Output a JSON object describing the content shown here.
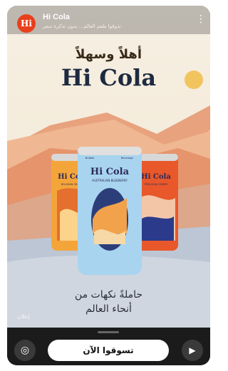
{
  "header": {
    "brand": "Hi Cola",
    "subtitle": "تذوقوا طعم العالم... بدون تذكرة سفر",
    "logo_text": "Hi",
    "menu_icon": "more-vertical-icon"
  },
  "hero": {
    "greeting": "أهلاً وسهلاً",
    "title": "Hi Cola",
    "tagline_line1": "حاملةً نكهات من",
    "tagline_line2": "أنحاء العالم"
  },
  "cans": {
    "left": {
      "brand": "Hi Cola",
      "flavor": "BOLIVIAN ORANGE"
    },
    "center": {
      "brand": "Hi Cola",
      "flavor": "AUSTRALIAN BLUEBERRY",
      "top_left": "Bubble",
      "top_right": "Beverage"
    },
    "right": {
      "brand": "Hi Cola",
      "flavor": "PERUVIAN CHERRY"
    }
  },
  "watermark": "إعلان",
  "actions": {
    "camera_icon": "camera-icon",
    "shop_label": "تسوقوا الآن",
    "send_icon": "send-icon"
  }
}
